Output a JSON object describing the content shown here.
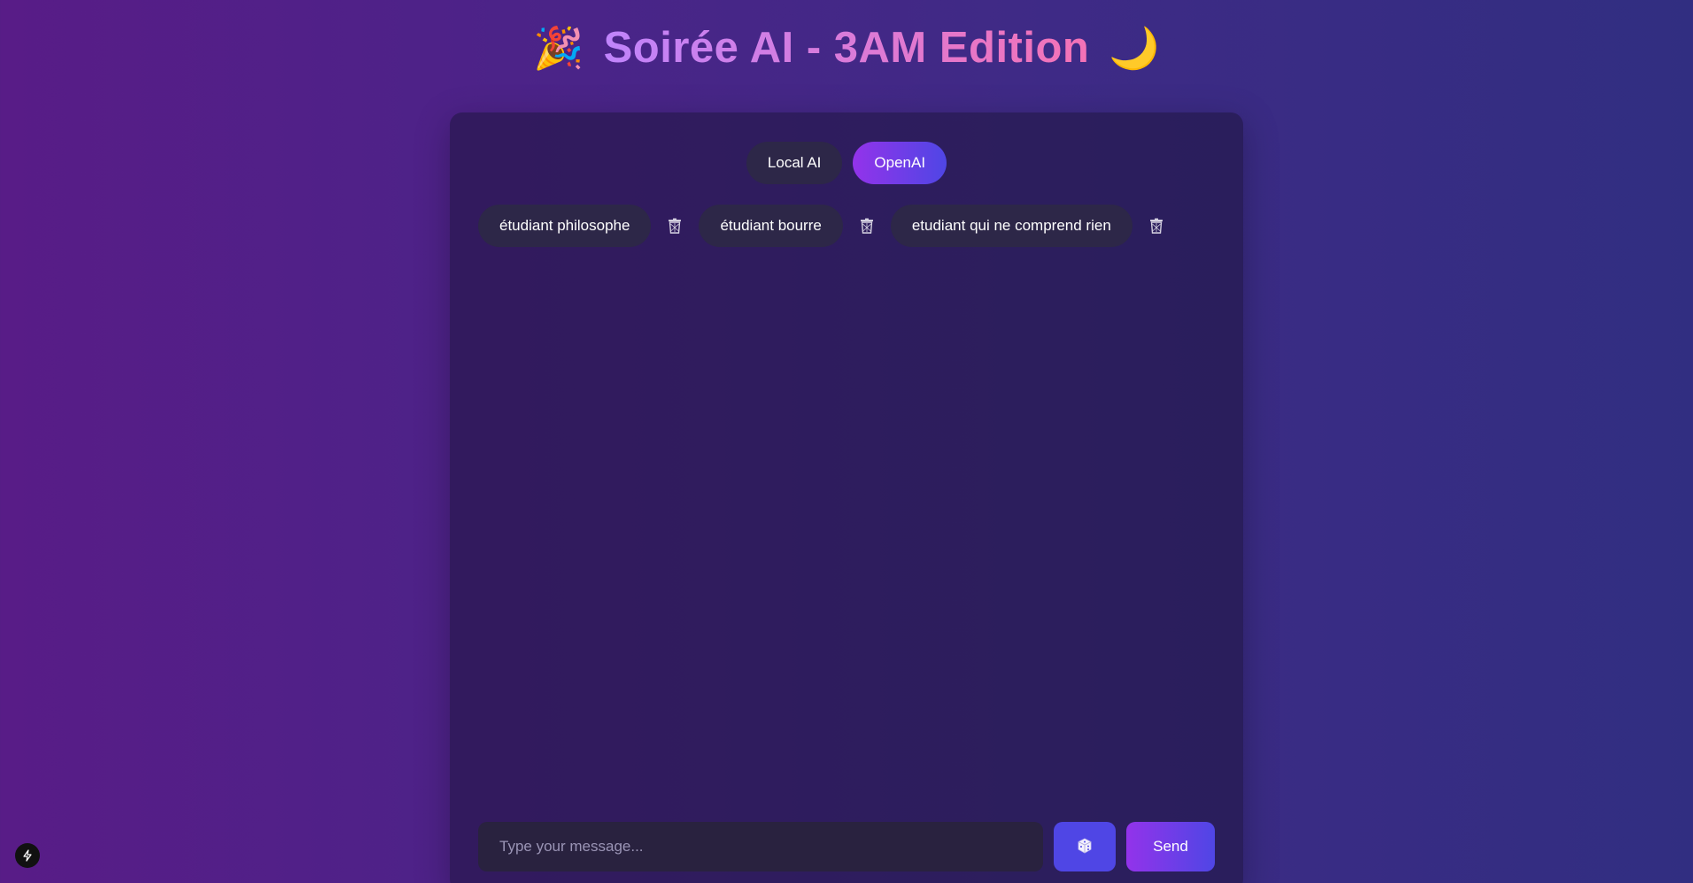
{
  "header": {
    "title": "Soirée AI - 3AM Edition",
    "left_icon": "party-popper-icon",
    "right_icon": "crescent-moon-icon"
  },
  "modes": {
    "local_label": "Local AI",
    "openai_label": "OpenAI",
    "active": "OpenAI"
  },
  "personas": [
    {
      "label": "étudiant philosophe",
      "delete_icon": "trash-icon"
    },
    {
      "label": "étudiant bourre",
      "delete_icon": "trash-icon"
    },
    {
      "label": "etudiant qui ne comprend rien",
      "delete_icon": "trash-icon"
    }
  ],
  "composer": {
    "placeholder": "Type your message...",
    "value": "",
    "dice_icon": "dice-icon",
    "send_label": "Send"
  },
  "colors": {
    "accent_purple": "#9333ea",
    "accent_indigo": "#4f46e5",
    "title_gradient_start": "#c084fc",
    "title_gradient_end": "#f472b6"
  },
  "corner_badge_icon": "lightning-icon"
}
